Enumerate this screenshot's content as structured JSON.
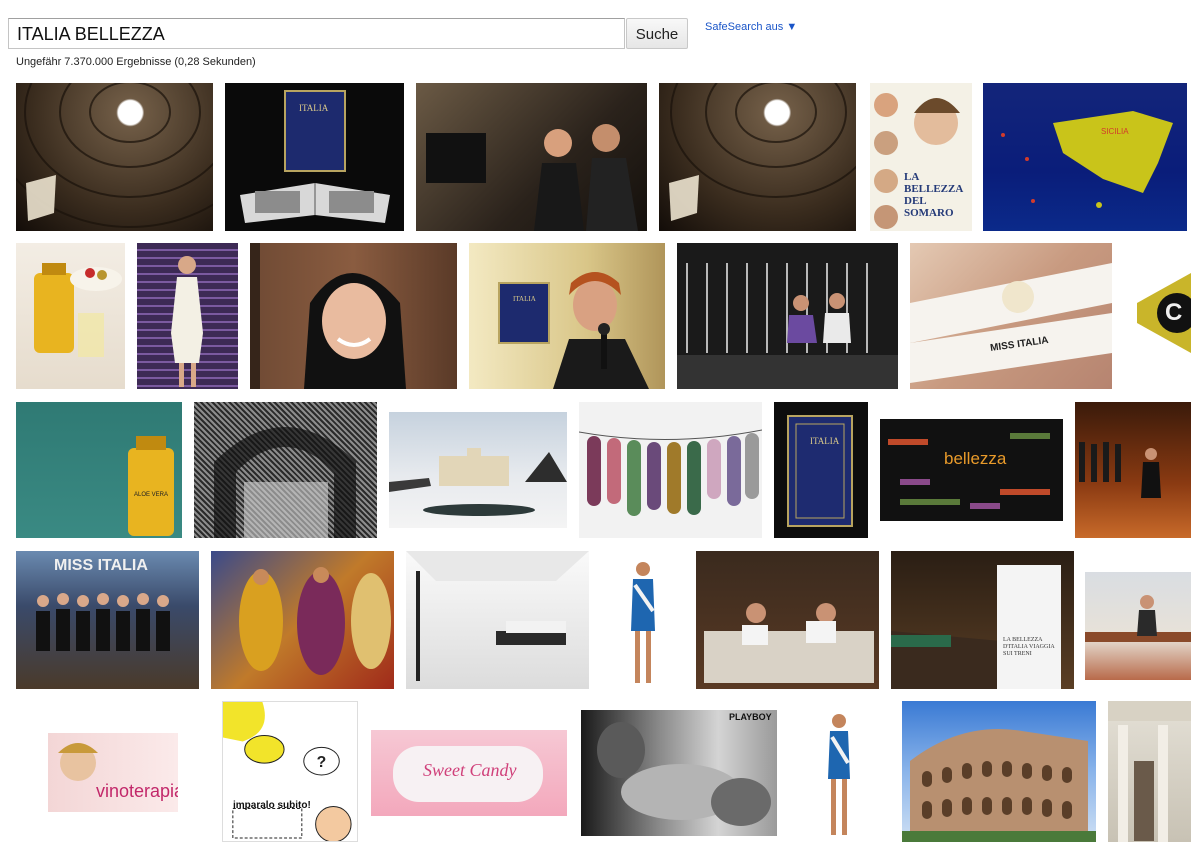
{
  "search": {
    "query": "ITALIA BELLEZZA",
    "button_label": "Suche",
    "safesearch_label": "SafeSearch aus ▼",
    "stats": "Ungefähr 7.370.000 Ergebnisse (0,28 Sekunden)"
  },
  "results": [
    {
      "name": "pantheon-dome-1",
      "text": ""
    },
    {
      "name": "italia-book-open",
      "text": "ITALIA"
    },
    {
      "name": "camera-interview",
      "text": ""
    },
    {
      "name": "pantheon-dome-2",
      "text": ""
    },
    {
      "name": "movie-poster",
      "text": "LA BELLEZZA DEL SOMARO"
    },
    {
      "name": "sicily-map",
      "text": "SICILIA"
    },
    {
      "name": "aloe-drink-breakfast",
      "text": ""
    },
    {
      "name": "model-white-dress",
      "text": ""
    },
    {
      "name": "woman-smiling-portrait",
      "text": ""
    },
    {
      "name": "woman-microphone",
      "text": "ITALIA"
    },
    {
      "name": "women-sitting-shutter",
      "text": ""
    },
    {
      "name": "miss-italia-sashes",
      "text": "MISS ITALIA"
    },
    {
      "name": "logo-partial",
      "text": "C"
    },
    {
      "name": "aloe-vera-gel",
      "text": "ALOE VERA"
    },
    {
      "name": "bw-arch-etching",
      "text": ""
    },
    {
      "name": "villa-snow",
      "text": ""
    },
    {
      "name": "clothesline-condoms",
      "text": ""
    },
    {
      "name": "italia-book-closed",
      "text": "ITALIA"
    },
    {
      "name": "word-cloud",
      "text": "bellezza"
    },
    {
      "name": "stage-contestants",
      "text": ""
    },
    {
      "name": "miss-italia-group",
      "text": "MISS ITALIA"
    },
    {
      "name": "dancers-painting",
      "text": ""
    },
    {
      "name": "white-bedroom",
      "text": ""
    },
    {
      "name": "model-swimsuit-1",
      "text": ""
    },
    {
      "name": "couple-in-bed",
      "text": ""
    },
    {
      "name": "train-station",
      "text": "LA BELLEZZA D'ITALIA VIAGGIA SUI TRENI"
    },
    {
      "name": "woman-bench-sea",
      "text": ""
    },
    {
      "name": "vinoterapia-ad",
      "text": "vinoterapia"
    },
    {
      "name": "comic-speech",
      "text": "imparalo subito!"
    },
    {
      "name": "sweet-candy",
      "text": "Sweet Candy"
    },
    {
      "name": "playboy-bw",
      "text": "PLAYBOY"
    },
    {
      "name": "model-swimsuit-2",
      "text": ""
    },
    {
      "name": "colosseum",
      "text": ""
    },
    {
      "name": "classical-portico",
      "text": ""
    }
  ],
  "colors": {
    "link": "#1a55c8",
    "border": "#c4c4c4"
  }
}
